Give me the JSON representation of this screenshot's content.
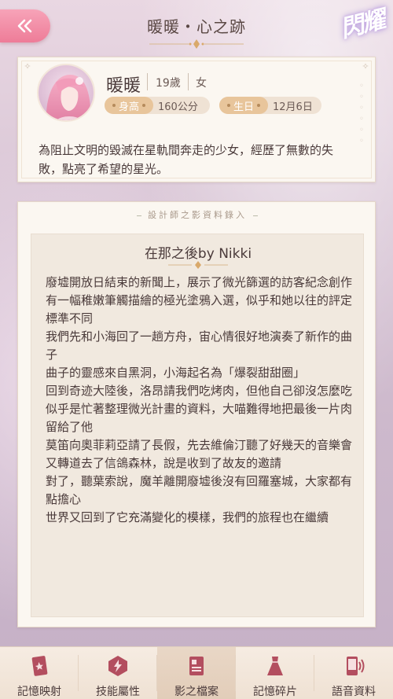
{
  "header": {
    "title": "暖暖・心之跡",
    "brand_text": "閃耀"
  },
  "profile": {
    "name": "暖暖",
    "age": "19歲",
    "gender": "女",
    "height_label": "身高",
    "height_value": "160公分",
    "birthday_label": "生日",
    "birthday_value": "12月6日",
    "bio": "為阻止文明的毀滅在星軌間奔走的少女，經歷了無數的失敗，點亮了希望的星光。"
  },
  "designer": {
    "heading": "設計師之影資料錄入",
    "entry_title": "在那之後by Nikki",
    "lines": [
      "廢墟開放日結束的新聞上，展示了微光篩選的訪客紀念創作",
      "有一幅稚嫩筆觸描繪的極光塗鴉入選，似乎和她以往的評定標準不同",
      "我們先和小海回了一趟方舟，宙心情很好地演奏了新作的曲子",
      "曲子的靈感來自黑洞，小海起名為「爆裂甜甜圈」",
      "回到奇迹大陸後，洛昂請我們吃烤肉，但他自己卻沒怎麼吃",
      "似乎是忙著整理微光計畫的資料，大喵難得地把最後一片肉留給了他",
      "莫笛向奧菲莉亞請了長假，先去維倫汀聽了好幾天的音樂會",
      "又轉道去了信鴿森林，說是收到了故友的邀請",
      "對了，聽葉索說，魔羊離開廢墟後沒有回羅塞城，大家都有點擔心",
      "世界又回到了它充滿變化的模樣，我們的旅程也在繼續"
    ]
  },
  "nav": {
    "items": [
      {
        "label": "記憶映射",
        "icon": "card-star-icon"
      },
      {
        "label": "技能屬性",
        "icon": "lightning-badge-icon"
      },
      {
        "label": "影之檔案",
        "icon": "document-icon"
      },
      {
        "label": "記憶碎片",
        "icon": "dress-icon"
      },
      {
        "label": "語音資料",
        "icon": "phone-voice-icon"
      }
    ],
    "active_index": 2
  },
  "colors": {
    "accent_pink": "#ee7c98",
    "tag_gold": "#e8c59b",
    "card_bg": "#fbf7f1"
  }
}
